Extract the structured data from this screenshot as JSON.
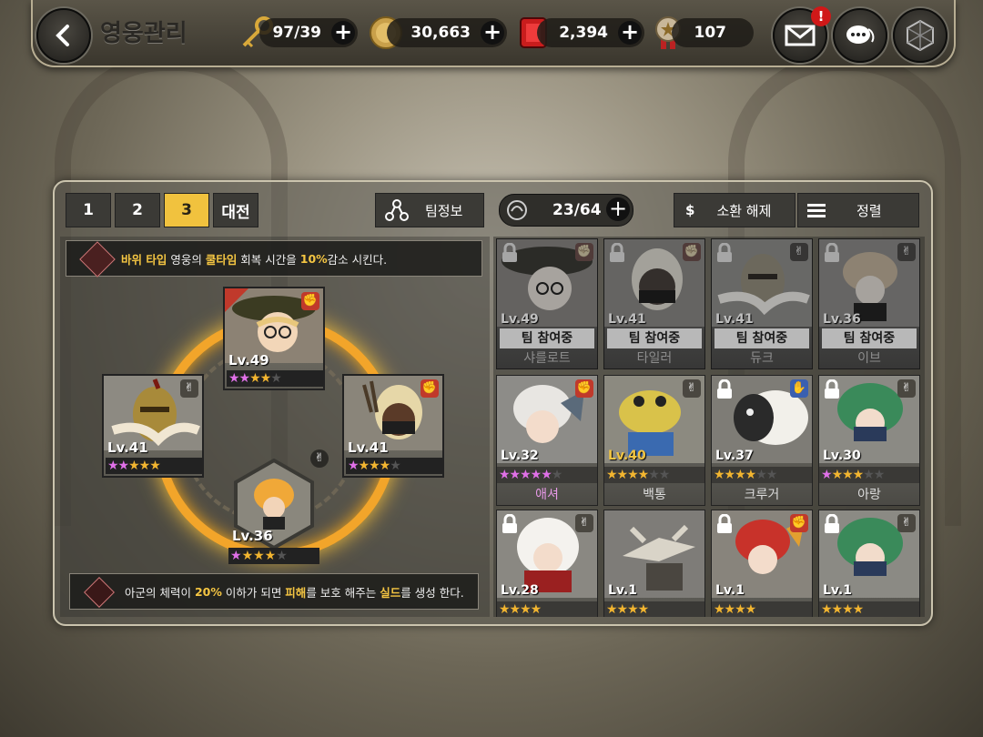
{
  "header": {
    "title": "영웅관리",
    "resources": [
      {
        "icon": "key-icon",
        "value": "97/39"
      },
      {
        "icon": "gold-coin-icon",
        "value": "30,663"
      },
      {
        "icon": "ruby-gem-icon",
        "value": "2,394"
      },
      {
        "icon": "medal-icon",
        "value": "107"
      }
    ],
    "mail_badge": "!"
  },
  "team_tabs": [
    "1",
    "2",
    "3",
    "대전"
  ],
  "active_tab": "3",
  "team_info_label": "팀정보",
  "hero_count": "23/64",
  "release_summon_label": "소환 해제",
  "sort_label": "정렬",
  "leader_skill": {
    "parts": [
      "바위 타입",
      " 영웅의 ",
      "쿨타임",
      " 회복 시간을 ",
      "10%",
      "감소 시킨다."
    ]
  },
  "passive_skill": {
    "parts": [
      "아군의 체력이 ",
      "20%",
      " 이하가 되면 ",
      "피해",
      "를 보호 해주는 ",
      "실드",
      "를 생성 한다."
    ]
  },
  "team_slots": [
    {
      "level": "Lv.49",
      "pink": 2,
      "gold": 2,
      "gray": 1,
      "element": "rock"
    },
    {
      "level": "Lv.41",
      "pink": 2,
      "gold": 3,
      "gray": 0,
      "element": "scissors"
    },
    {
      "level": "Lv.41",
      "pink": 1,
      "gold": 3,
      "gray": 1,
      "element": "rock"
    },
    {
      "level": "Lv.36",
      "pink": 1,
      "gold": 3,
      "gray": 1,
      "element": "scissors"
    }
  ],
  "hero_list": [
    {
      "level": "Lv.49",
      "name": "샤를로트",
      "status": "팀 참여중",
      "locked": true,
      "element": "rock"
    },
    {
      "level": "Lv.41",
      "name": "타일러",
      "status": "팀 참여중",
      "locked": true,
      "element": "rock"
    },
    {
      "level": "Lv.41",
      "name": "듀크",
      "status": "팀 참여중",
      "locked": true,
      "element": "scissors"
    },
    {
      "level": "Lv.36",
      "name": "이브",
      "status": "팀 참여중",
      "locked": true,
      "element": "scissors"
    },
    {
      "level": "Lv.32",
      "name": "애셔",
      "status": "",
      "locked": false,
      "element": "rock",
      "pink": 5,
      "gold": 0,
      "gray": 1
    },
    {
      "level": "Lv.40",
      "name": "백통",
      "status": "",
      "locked": false,
      "element": "scissors",
      "pink": 0,
      "gold": 4,
      "gray": 2
    },
    {
      "level": "Lv.37",
      "name": "크루거",
      "status": "",
      "locked": true,
      "element": "paper",
      "pink": 0,
      "gold": 4,
      "gray": 2
    },
    {
      "level": "Lv.30",
      "name": "아랑",
      "status": "",
      "locked": true,
      "element": "scissors",
      "pink": 1,
      "gold": 3,
      "gray": 2
    },
    {
      "level": "Lv.28",
      "name": "",
      "status": "",
      "locked": true,
      "element": "scissors",
      "pink": 0,
      "gold": 4,
      "gray": 0
    },
    {
      "level": "Lv.1",
      "name": "",
      "status": "",
      "locked": false,
      "element": "none",
      "pink": 0,
      "gold": 4,
      "gray": 0
    },
    {
      "level": "Lv.1",
      "name": "",
      "status": "",
      "locked": true,
      "element": "rock",
      "pink": 0,
      "gold": 4,
      "gray": 0
    },
    {
      "level": "Lv.1",
      "name": "",
      "status": "",
      "locked": true,
      "element": "scissors",
      "pink": 0,
      "gold": 4,
      "gray": 0
    }
  ],
  "colors": {
    "accent": "#f1c23e",
    "pink_star": "#e070e8",
    "gold_star": "#f2b530",
    "rock_badge": "#c0392b",
    "paper_badge": "#3a5fb0"
  }
}
